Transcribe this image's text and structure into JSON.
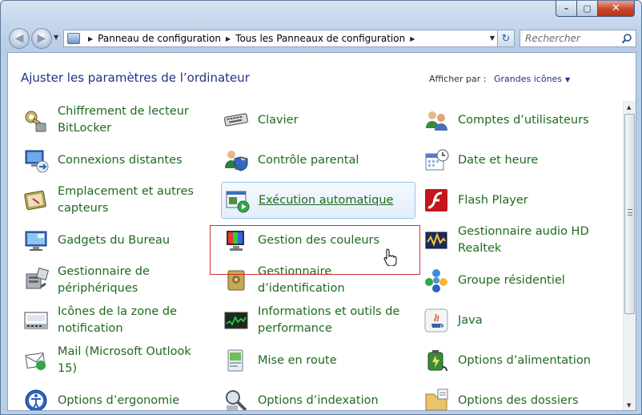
{
  "window": {
    "buttons": {
      "minimize": "–",
      "maximize": "▢",
      "close": "✕"
    }
  },
  "nav": {
    "breadcrumb": [
      "Panneau de configuration",
      "Tous les Panneaux de configuration"
    ],
    "search_placeholder": "Rechercher"
  },
  "header": {
    "title": "Ajuster les paramètres de l’ordinateur",
    "view_label": "Afficher par :",
    "view_value": "Grandes icônes"
  },
  "items": [
    [
      "Chiffrement de lecteur BitLocker",
      "Clavier",
      "Comptes d’utilisateurs"
    ],
    [
      "Connexions distantes",
      "Contrôle parental",
      "Date et heure"
    ],
    [
      "Emplacement et autres capteurs",
      "Exécution automatique",
      "Flash Player"
    ],
    [
      "Gadgets du Bureau",
      "Gestion des couleurs",
      "Gestionnaire audio HD Realtek"
    ],
    [
      "Gestionnaire de périphériques",
      "Gestionnaire d’identification",
      "Groupe résidentiel"
    ],
    [
      "Icônes de la zone de notification",
      "Informations et outils de performance",
      "Java"
    ],
    [
      "Mail (Microsoft Outlook 15)",
      "Mise en route",
      "Options d’alimentation"
    ],
    [
      "Options d’ergonomie",
      "Options d’indexation",
      "Options des dossiers"
    ]
  ],
  "icons": [
    [
      "key-lock-icon",
      "keyboard-icon",
      "users-icon"
    ],
    [
      "remote-desktop-icon",
      "parental-control-icon",
      "calendar-clock-icon"
    ],
    [
      "location-sensor-icon",
      "autoplay-icon",
      "flash-player-icon"
    ],
    [
      "desktop-gadgets-icon",
      "color-management-icon",
      "realtek-audio-icon"
    ],
    [
      "device-manager-icon",
      "credential-manager-icon",
      "homegroup-icon"
    ],
    [
      "notification-area-icon",
      "performance-icon",
      "java-icon"
    ],
    [
      "mail-icon",
      "getting-started-icon",
      "power-options-icon"
    ],
    [
      "ease-of-access-icon",
      "indexing-icon",
      "folder-options-icon"
    ]
  ],
  "colors": {
    "link": "#1e6a1e",
    "title": "#1e3287",
    "highlight_border": "#d22d2d"
  }
}
